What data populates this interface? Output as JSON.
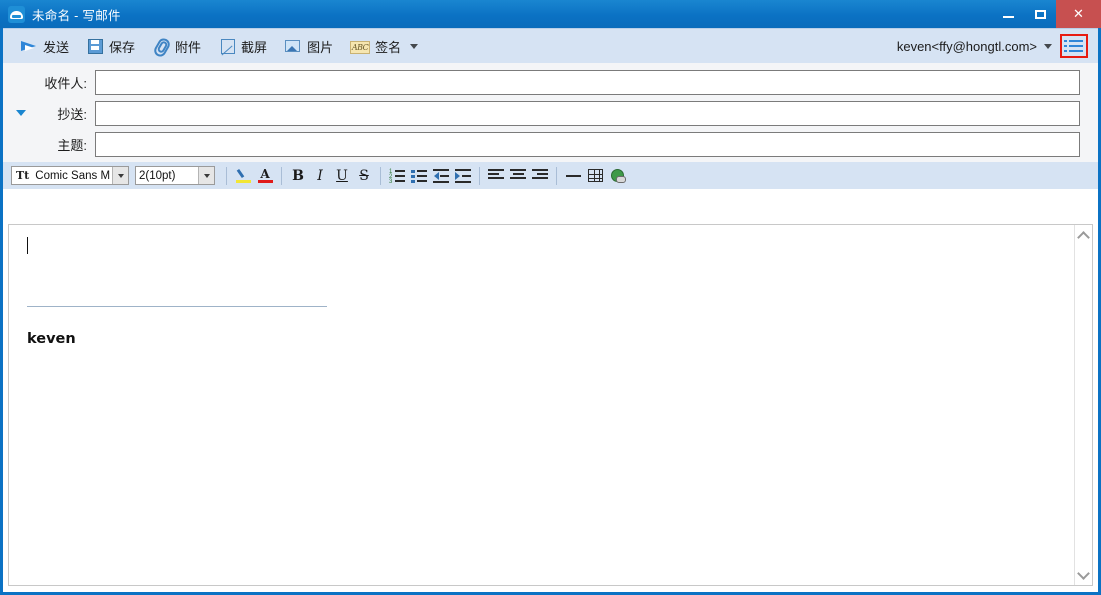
{
  "window": {
    "title": "未命名 - 写邮件",
    "app_icon": "mail-cloud-icon",
    "controls": {
      "minimize": "最小化",
      "maximize": "最大化",
      "close": "✕"
    },
    "frame_color": "#0b72c4",
    "close_color": "#c75050"
  },
  "toolbar": {
    "items": [
      {
        "label": "发送",
        "icon": "send-plane-icon"
      },
      {
        "label": "保存",
        "icon": "floppy-disk-icon"
      },
      {
        "label": "附件",
        "icon": "paperclip-icon"
      },
      {
        "label": "截屏",
        "icon": "screen-capture-icon"
      },
      {
        "label": "图片",
        "icon": "picture-icon"
      },
      {
        "label": "签名",
        "icon": "signature-abc-icon",
        "caret": true
      }
    ],
    "signature_icon_text": "ABC",
    "account": "keven<ffy@hongtl.com>",
    "menu_button_icon": "list-menu-icon",
    "menu_button_highlight": "#e81b10",
    "background": "#d6e3f3"
  },
  "fields": [
    {
      "label": "收件人:",
      "value": "",
      "expander": false
    },
    {
      "label": "抄送:",
      "value": "",
      "expander": true
    },
    {
      "label": "主题:",
      "value": "",
      "expander": false
    }
  ],
  "format_bar": {
    "font_name": "Comic Sans M",
    "font_size": "2(10pt)",
    "font_icon": "font-T-icon",
    "buttons": [
      {
        "name": "highlight-color-button",
        "icon": "highlight-pen-icon"
      },
      {
        "name": "font-color-button",
        "icon": "font-color-A-icon",
        "glyph": "A"
      },
      {
        "name": "bold-button",
        "glyph": "B"
      },
      {
        "name": "italic-button",
        "glyph": "I"
      },
      {
        "name": "underline-button",
        "glyph": "U"
      },
      {
        "name": "strikethrough-button",
        "glyph": "S"
      },
      {
        "name": "numbered-list-button",
        "icon": "numbered-list-icon"
      },
      {
        "name": "bullet-list-button",
        "icon": "bullet-list-icon"
      },
      {
        "name": "decrease-indent-button",
        "icon": "decrease-indent-icon"
      },
      {
        "name": "increase-indent-button",
        "icon": "increase-indent-icon"
      },
      {
        "name": "align-left-button",
        "icon": "align-left-icon"
      },
      {
        "name": "align-center-button",
        "icon": "align-center-icon"
      },
      {
        "name": "align-right-button",
        "icon": "align-right-icon"
      },
      {
        "name": "horizontal-rule-button",
        "icon": "horizontal-rule-icon"
      },
      {
        "name": "insert-table-button",
        "icon": "table-icon"
      },
      {
        "name": "insert-hyperlink-button",
        "icon": "globe-link-icon"
      }
    ]
  },
  "body": {
    "content": "",
    "signature_text": "keven",
    "separator_color": "#9fb3c8",
    "scrollbar": {
      "up": "scroll-up-icon",
      "down": "scroll-down-icon"
    }
  }
}
